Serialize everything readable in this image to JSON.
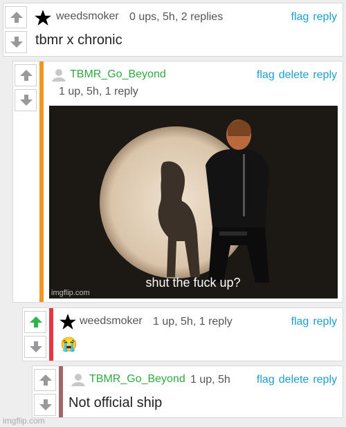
{
  "comments": [
    {
      "user": "weedsmoker",
      "meta": "0 ups, 5h, 2 replies",
      "actions": {
        "flag": "flag",
        "reply": "reply"
      },
      "text": "tbmr x chronic"
    },
    {
      "user": "TBMR_Go_Beyond",
      "meta": "1 up, 5h, 1 reply",
      "actions": {
        "flag": "flag",
        "delete": "delete",
        "reply": "reply"
      },
      "meme": {
        "caption": "shut the fuck up?",
        "watermark": "imgflip.com"
      }
    },
    {
      "user": "weedsmoker",
      "meta": "1 up, 5h, 1 reply",
      "actions": {
        "flag": "flag",
        "reply": "reply"
      },
      "text": "😭"
    },
    {
      "user": "TBMR_Go_Beyond",
      "meta": "1 up, 5h",
      "actions": {
        "flag": "flag",
        "delete": "delete",
        "reply": "reply"
      },
      "text": "Not official ship"
    }
  ],
  "footer": "imgflip.com",
  "colors": {
    "bar_orange": "#f7941d",
    "bar_red": "#ee3340",
    "bar_brown": "#a06767",
    "upvote_active": "#2fb34a",
    "link": "#1a9ed4",
    "username_green": "#2eaa3f"
  },
  "icons": [
    "upvote-icon",
    "downvote-icon",
    "star-icon",
    "avatar-icon"
  ]
}
